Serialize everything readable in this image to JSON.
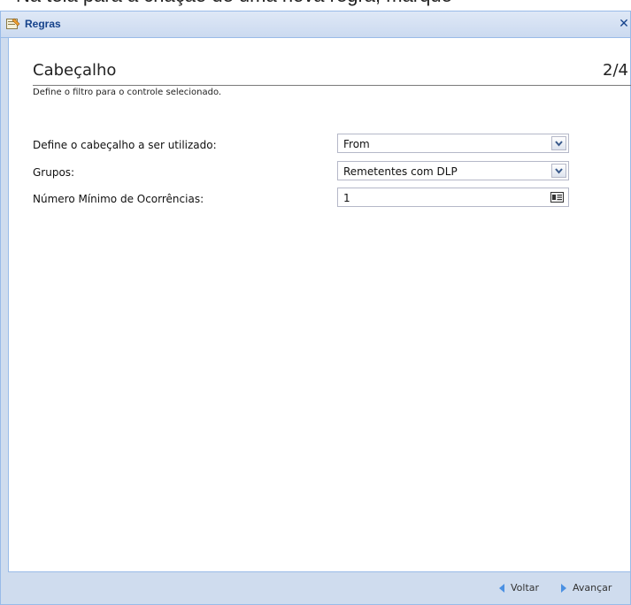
{
  "cropped_instruction": "Na tela para a criação de uma nova regra, marque",
  "window": {
    "title": "Regras",
    "close_glyph": "✕",
    "icon": "rules-window-icon"
  },
  "header": {
    "title": "Cabeçalho",
    "step": "2/4",
    "description": "Define o filtro para o controle selecionado."
  },
  "form": {
    "header_label": "Define o cabeçalho a ser utilizado:",
    "header_value": "From",
    "groups_label": "Grupos:",
    "groups_value": "Remetentes com DLP",
    "min_occ_label": "Número Mínimo de Ocorrências:",
    "min_occ_value": "1"
  },
  "footer": {
    "back_label": "Voltar",
    "next_label": "Avançar"
  },
  "colors": {
    "title_text": "#15428b",
    "nav_arrow": "#4a90e2",
    "border": "#99bbe8"
  }
}
